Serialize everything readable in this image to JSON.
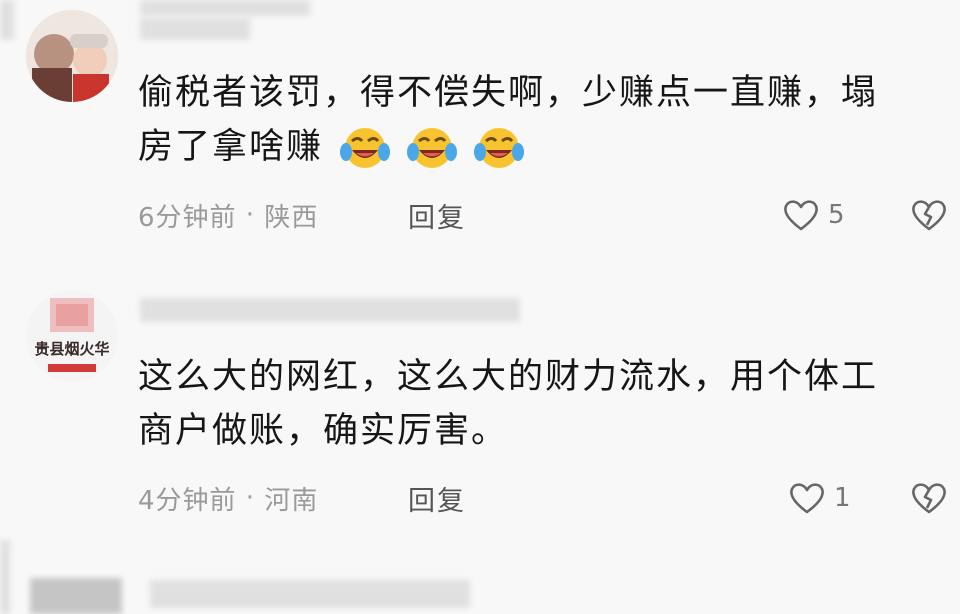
{
  "comments": [
    {
      "text_line1": "偷税者该罚，得不偿失啊，少赚点一直赚，塌",
      "text_line2": "房了拿啥赚",
      "emojis": [
        "face-with-tears-of-joy-icon",
        "face-with-tears-of-joy-icon",
        "face-with-tears-of-joy-icon"
      ],
      "time": "6分钟前",
      "separator": " · ",
      "location": "陕西",
      "reply_label": "回复",
      "like_count": "5"
    },
    {
      "text_line1": "这么大的网红，这么大的财力流水，用个体工",
      "text_line2": "商户做账，确实厉害。",
      "avatar_text": "贵县烟火华",
      "time": "4分钟前",
      "separator": " · ",
      "location": "河南",
      "reply_label": "回复",
      "like_count": "1"
    }
  ],
  "colors": {
    "background": "#f8f8f8",
    "meta": "#9a9a9a",
    "text": "#161616"
  }
}
